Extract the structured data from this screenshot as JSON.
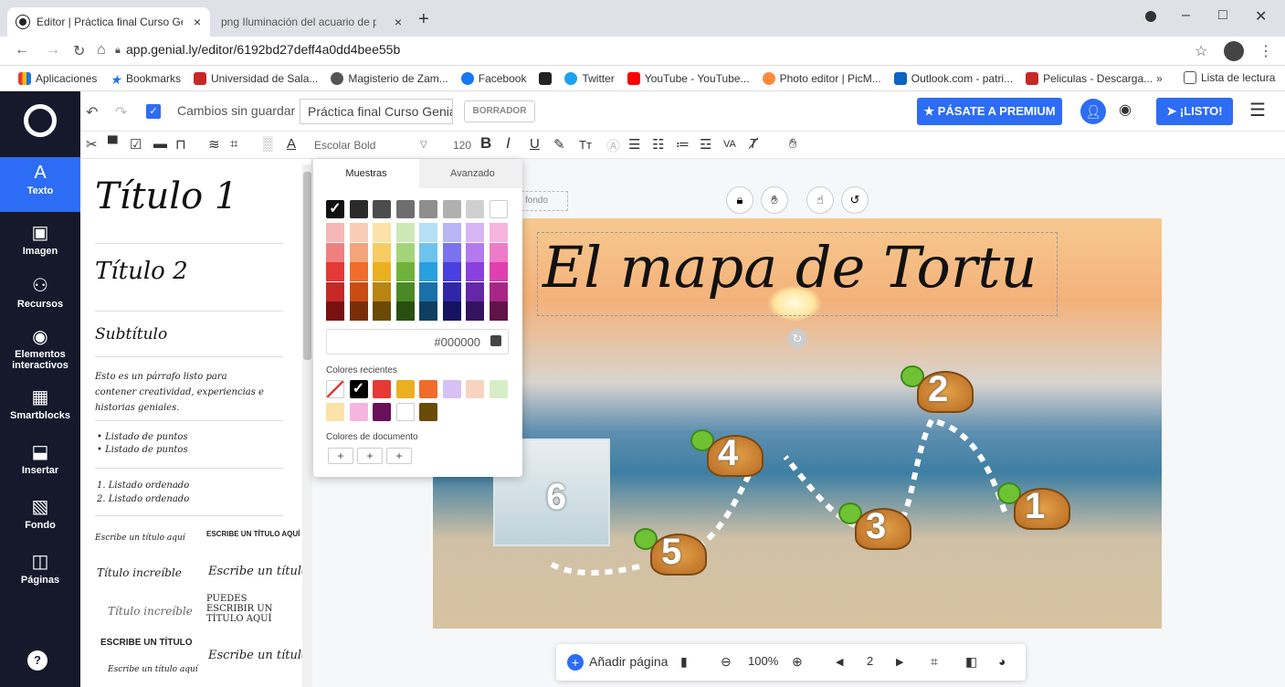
{
  "browser": {
    "tabs": [
      {
        "label": "Editor | Práctica final Curso Genia",
        "close": "×"
      },
      {
        "label": "png Iluminación del acuario de peces",
        "close": "×"
      }
    ],
    "new_tab": "+",
    "url": "app.genial.ly/editor/6192bd27deff4a0dd4bee55b"
  },
  "bookmarks": [
    {
      "label": "Aplicaciones",
      "color": "#e53935"
    },
    {
      "label": "Bookmarks",
      "color": "#1a73e8"
    },
    {
      "label": "Universidad de Sala...",
      "color": "#c62828"
    },
    {
      "label": "Magisterio de Zam...",
      "color": "#555555"
    },
    {
      "label": "Facebook",
      "color": "#1877f2"
    },
    {
      "label": "",
      "color": "#222222"
    },
    {
      "label": "Twitter",
      "color": "#1da1f2"
    },
    {
      "label": "YouTube - YouTube...",
      "color": "#ff0000"
    },
    {
      "label": "Photo editor | PicM...",
      "color": "#ff8a3d"
    },
    {
      "label": "Outlook.com - patri...",
      "color": "#0a64c2"
    },
    {
      "label": "Peliculas - Descarga...",
      "color": "#c62828"
    }
  ],
  "reading_list": "Lista de lectura",
  "more_bookmarks": "»",
  "sidebar": {
    "items": [
      {
        "label": "Texto",
        "icon": "A"
      },
      {
        "label": "Imagen",
        "icon": "▣"
      },
      {
        "label": "Recursos",
        "icon": "⚇"
      },
      {
        "label": "Elementos interactivos",
        "icon": "◉"
      },
      {
        "label": "Smartblocks",
        "icon": "▦"
      },
      {
        "label": "Insertar",
        "icon": "⬓"
      },
      {
        "label": "Fondo",
        "icon": "▧"
      },
      {
        "label": "Páginas",
        "icon": "◫"
      }
    ],
    "help": "?"
  },
  "topbar": {
    "unsaved": "Cambios sin guardar",
    "title": "Práctica final Curso Genial",
    "draft": "BORRADOR",
    "premium": "PÁSATE A PREMIUM",
    "listo": "¡LISTO!"
  },
  "format": {
    "font": "Escolar Bold",
    "size": "120"
  },
  "panel": {
    "h1": "Título 1",
    "h2": "Título 2",
    "h3": "Subtítulo",
    "paragraph": "Esto es un párrafo listo para contener creatividad, experiencias e historias geniales.",
    "bullets": [
      "Listado de puntos",
      "Listado de puntos"
    ],
    "ordered": [
      "1. Listado ordenado",
      "2. Listado ordenado"
    ],
    "templates": [
      "Escribe un título aquí",
      "ESCRIBE UN TÍTULO AQUÍ",
      "Título increíble",
      "Escribe un título",
      "Título increíble",
      "PUEDES ESCRIBIR UN TÍTULO AQUÍ",
      "ESCRIBE UN TÍTULO",
      "Escribe un título",
      "Escribe un título aquí"
    ]
  },
  "picker": {
    "tabs": [
      "Muestras",
      "Avanzado"
    ],
    "hex": "#000000",
    "recent_label": "Colores recientes",
    "doc_label": "Colores de documento",
    "greys": [
      "#111111",
      "#2b2b2b",
      "#4d4d4d",
      "#6e6e6e",
      "#8e8e8e",
      "#b0b0b0",
      "#d0d0d0",
      "#ffffff"
    ],
    "columns": [
      [
        "#f7b7b7",
        "#f08080",
        "#e53935",
        "#c62828",
        "#7a1010"
      ],
      [
        "#f9cdb5",
        "#f4a47a",
        "#ef6c2a",
        "#c94d12",
        "#7a2e08"
      ],
      [
        "#fbe2a8",
        "#f7cc62",
        "#eab020",
        "#b88412",
        "#6b4a06"
      ],
      [
        "#cde8b5",
        "#a3d47a",
        "#6fb33a",
        "#4a8a22",
        "#294f10"
      ],
      [
        "#b5dff5",
        "#6cc3ee",
        "#2a9fdf",
        "#1a70a8",
        "#0e3f60"
      ],
      [
        "#b8b5f5",
        "#7a72ee",
        "#4a3fdf",
        "#2f27a8",
        "#171360"
      ],
      [
        "#d7b5f5",
        "#b37aee",
        "#8a3fdf",
        "#6427a8",
        "#361360"
      ],
      [
        "#f5b5de",
        "#ee7ac8",
        "#df3faf",
        "#a82784",
        "#601349"
      ]
    ],
    "recent": [
      "slash",
      "#000000",
      "#e53935",
      "#eab020",
      "#ef6c2a",
      "#d8c0f5",
      "#f7d3c0",
      "#d6eec8",
      "#fbe2a8",
      "#f5b5de",
      "#6a0f5a",
      "#ffffff",
      "#6b4a06"
    ],
    "doc_plus": [
      "+",
      "+",
      "+"
    ]
  },
  "canvas": {
    "title": "El mapa de Tortu",
    "fondo": "fondo",
    "turtles": [
      "1",
      "2",
      "3",
      "4",
      "5"
    ],
    "aquarium_number": "6"
  },
  "bottom": {
    "add_page": "Añadir página",
    "zoom": "100%",
    "page": "2"
  }
}
